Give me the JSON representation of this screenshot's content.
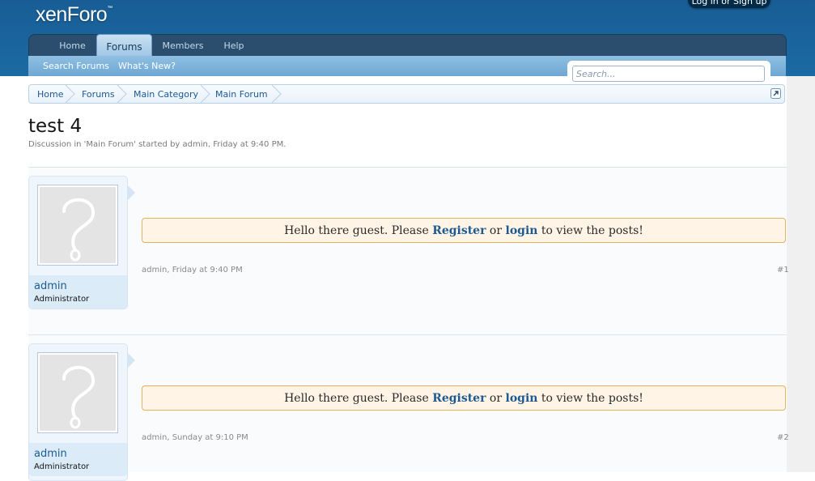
{
  "header": {
    "logo": "xenForo",
    "logo_mark": "™",
    "login": "Log in or Sign up"
  },
  "nav": {
    "tabs": [
      "Home",
      "Forums",
      "Members",
      "Help"
    ],
    "active": "Forums",
    "subnav": [
      "Search Forums",
      "What's New?"
    ]
  },
  "search": {
    "placeholder": "Search..."
  },
  "breadcrumb": [
    "Home",
    "Forums",
    "Main Category",
    "Main Forum"
  ],
  "thread": {
    "title": "test 4",
    "desc_pre": "Discussion in '",
    "desc_forum": "Main Forum",
    "desc_mid": "' started by ",
    "desc_author": "admin",
    "desc_date": ", Friday at 9:40 PM",
    "desc_end": "."
  },
  "notice": {
    "pre": "Hello there guest. Please ",
    "register": "Register",
    "or": " or ",
    "login": "login",
    "post": " to view the posts!"
  },
  "posts": [
    {
      "username": "admin",
      "usertitle": "Administrator",
      "meta": "admin, Friday at 9:40 PM",
      "num": "#1"
    },
    {
      "username": "admin",
      "usertitle": "Administrator",
      "meta": "admin, Sunday at 9:10 PM",
      "num": "#2"
    }
  ],
  "icons": {
    "jump": "jump-menu-icon",
    "avatar": "question-mark-avatar-icon"
  },
  "colors": {
    "header": "#185d96",
    "link": "#1d5a91",
    "notice_bg": "#fff4e5",
    "notice_border": "#e4b35a"
  }
}
